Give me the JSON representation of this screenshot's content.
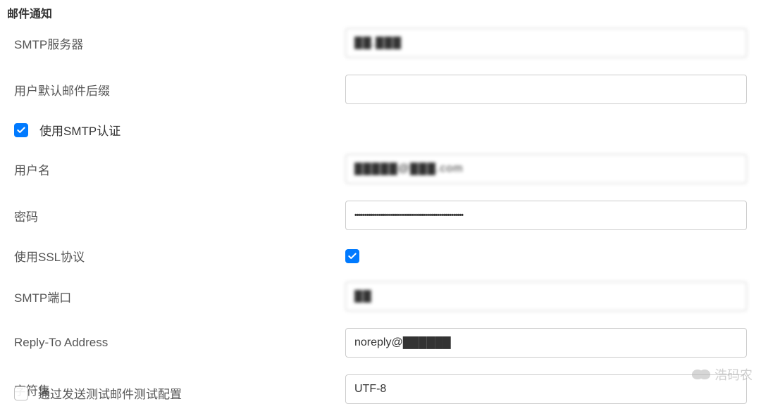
{
  "section": {
    "title": "邮件通知"
  },
  "fields": {
    "smtp_server": {
      "label": "SMTP服务器",
      "value": "██.███"
    },
    "default_suffix": {
      "label": "用户默认邮件后缀",
      "value": ""
    },
    "use_smtp_auth": {
      "label": "使用SMTP认证",
      "checked": true
    },
    "username": {
      "label": "用户名",
      "value": "█████@███.com"
    },
    "password": {
      "label": "密码",
      "value": "••••••••••••••••••••••••••••••••••••••••••••••••••••••"
    },
    "use_ssl": {
      "label": "使用SSL协议",
      "checked": true
    },
    "smtp_port": {
      "label": "SMTP端口",
      "value": "██"
    },
    "reply_to": {
      "label": "Reply-To Address",
      "value": "noreply@██████"
    },
    "charset": {
      "label": "字符集",
      "value": "UTF-8"
    }
  },
  "truncated": {
    "label": "通过发送测试邮件测试配置"
  },
  "watermark": {
    "text": "浩码农"
  }
}
